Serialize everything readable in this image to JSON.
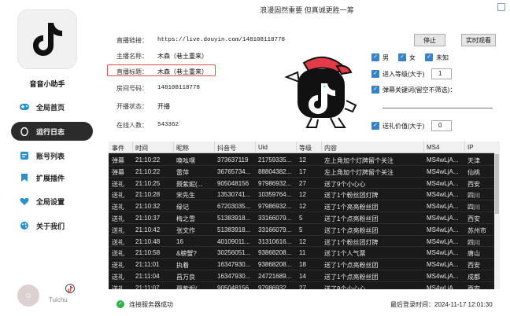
{
  "app": {
    "name": "音音小助手",
    "title": "浪漫固然重要 但真诚更胜一筹",
    "user": "Tuichu"
  },
  "nav": [
    {
      "label": "全局首页",
      "icon": "gamepad-icon"
    },
    {
      "label": "运行日志",
      "icon": "egg-icon"
    },
    {
      "label": "账号列表",
      "icon": "id-card-icon"
    },
    {
      "label": "扩展插件",
      "icon": "bookmark-icon"
    },
    {
      "label": "全局设置",
      "icon": "heart-icon"
    },
    {
      "label": "关于我们",
      "icon": "palette-icon"
    }
  ],
  "form": {
    "link_label": "直播链接：",
    "link_value": "https://live.douyin.com/148108118778",
    "host_label": "主播名称：",
    "host_value": "木森（巷土重来）",
    "roomtitle_label": "直播标题：",
    "roomtitle_value": "木森（巷土重来）",
    "roomid_label": "房间号码：",
    "roomid_value": "148108118778",
    "status_label": "开播状态：",
    "status_value": "开播",
    "online_label": "在线人数：",
    "online_value": "543362",
    "stop_btn": "停止",
    "watch_btn": "实时观看"
  },
  "filters": {
    "male": "男",
    "female": "女",
    "unknown": "未知",
    "level_label": "进入等级(大于)",
    "level_value": "1",
    "keyword_label": "弹幕关键词(留空不筛选)：",
    "gift_label": "送礼价值(大于)",
    "gift_value": "0"
  },
  "table": {
    "headers": [
      "事件",
      "时间",
      "昵称",
      "抖音号",
      "Uid",
      "等级",
      "内容",
      "MS4",
      "IP"
    ],
    "rows": [
      [
        "弹幕",
        "21:10:22",
        "唤吆嘿",
        "373637119",
        "21759335...",
        "12",
        "左上角加个灯牌留个关注",
        "MS4wLjA...",
        "天津"
      ],
      [
        "弹幕",
        "21:10:22",
        "雷萍",
        "36765734...",
        "88804382...",
        "17",
        "左上角加个灯牌留个关注",
        "MS4wLjA...",
        "仙桃"
      ],
      [
        "送礼",
        "21:10:25",
        "聂紫妮(...",
        "905048156",
        "97986932...",
        "27",
        "送了9个小心心",
        "MS4wLjA...",
        "西安"
      ],
      [
        "送礼",
        "21:10:28",
        "宋先生",
        "13530741...",
        "10359764...",
        "12",
        "送了1个粉丝团灯牌",
        "MS4wLjA...",
        "四川"
      ],
      [
        "送礼",
        "21:10:32",
        "缘记",
        "67203035...",
        "97986932...",
        "12",
        "送了1个亮亮粉丝团",
        "MS4wLjA...",
        "四川"
      ],
      [
        "送礼",
        "21:10:37",
        "梅之雪",
        "51383918...",
        "33166079...",
        "5",
        "送了1个点亮粉丝团",
        "MS4wLjA...",
        "西安"
      ],
      [
        "送礼",
        "21:10:42",
        "张文作",
        "51383918...",
        "33166079...",
        "5",
        "送了1个点亮粉丝团",
        "MS4wLjA...",
        "苏州市"
      ],
      [
        "送礼",
        "21:10:48",
        "16",
        "40109011...",
        "31310616...",
        "12",
        "送了1个粉丝团灯牌",
        "MS4wLjA...",
        "四川"
      ],
      [
        "送礼",
        "21:10:58",
        "&螃蟹?",
        "30256051...",
        "93868208...",
        "11",
        "送了1个人气票",
        "MS4wLjA...",
        "唐山"
      ],
      [
        "送礼",
        "21:11:01",
        "执着",
        "16347930...",
        "93868208...",
        "18",
        "送了1个点亮粉丝团",
        "MS4wLjA...",
        "西安"
      ],
      [
        "送礼",
        "21:11:04",
        "昌万良",
        "16347930...",
        "24721689...",
        "14",
        "送了1个点亮粉丝团",
        "MS4wLjA...",
        "成都"
      ],
      [
        "送礼",
        "21:11:07",
        "聂紫妮(...",
        "905048156",
        "97986932...",
        "27",
        "送了9个小心心",
        "MS4wLjA...",
        "西安"
      ]
    ]
  },
  "status": {
    "text": "连接服务器成功",
    "login": "最后登录时间：2024-11-17 12:01:30"
  }
}
